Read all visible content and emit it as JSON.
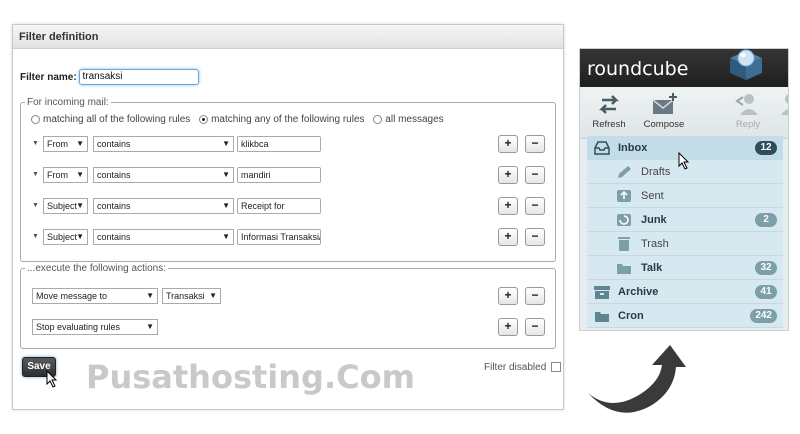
{
  "filter_panel": {
    "header": "Filter definition",
    "name_label": "Filter name:",
    "name_value": "transaksi",
    "rules_legend": "For incoming mail:",
    "match_options": [
      {
        "label": "matching all of the following rules",
        "selected": false
      },
      {
        "label": "matching any of the following rules",
        "selected": true
      },
      {
        "label": "all messages",
        "selected": false
      }
    ],
    "rules": [
      {
        "header": "From",
        "operator": "contains",
        "value": "klikbca"
      },
      {
        "header": "From",
        "operator": "contains",
        "value": "mandiri"
      },
      {
        "header": "Subject",
        "operator": "contains",
        "value": "Receipt for"
      },
      {
        "header": "Subject",
        "operator": "contains",
        "value": "Informasi Transaksi/Tra"
      }
    ],
    "actions_legend": "...execute the following actions:",
    "actions": [
      {
        "action": "Move message to",
        "target": "Transaksi"
      },
      {
        "action": "Stop evaluating rules",
        "target": ""
      }
    ],
    "plus_label": "+",
    "minus_label": "−",
    "save_label": "Save",
    "filter_disabled_label": "Filter disabled",
    "watermark": "Pusathosting.Com"
  },
  "roundcube": {
    "logo": "roundcube",
    "toolbar": {
      "refresh": "Refresh",
      "compose": "Compose",
      "reply": "Reply",
      "reply_all": "R"
    },
    "folders": [
      {
        "name": "Inbox",
        "count": "12",
        "icon": "inbox-icon",
        "bold": true,
        "sub": false,
        "selected": true
      },
      {
        "name": "Drafts",
        "count": "",
        "icon": "pencil-icon",
        "bold": false,
        "sub": true,
        "selected": false
      },
      {
        "name": "Sent",
        "count": "",
        "icon": "sent-icon",
        "bold": false,
        "sub": true,
        "selected": false
      },
      {
        "name": "Junk",
        "count": "2",
        "icon": "junk-icon",
        "bold": true,
        "sub": true,
        "selected": false
      },
      {
        "name": "Trash",
        "count": "",
        "icon": "trash-icon",
        "bold": false,
        "sub": true,
        "selected": false
      },
      {
        "name": "Talk",
        "count": "32",
        "icon": "folder-icon",
        "bold": true,
        "sub": true,
        "selected": false
      },
      {
        "name": "Archive",
        "count": "41",
        "icon": "archive-icon",
        "bold": true,
        "sub": false,
        "selected": false
      },
      {
        "name": "Cron",
        "count": "242",
        "icon": "folder-icon",
        "bold": true,
        "sub": false,
        "selected": false
      }
    ]
  },
  "colors": {
    "rc_badge_selected": "#2f4e5c",
    "rc_badge": "#7d9fa9",
    "rc_folder_bg": "#d6e8f0",
    "save_button": "#3a3a3a"
  }
}
